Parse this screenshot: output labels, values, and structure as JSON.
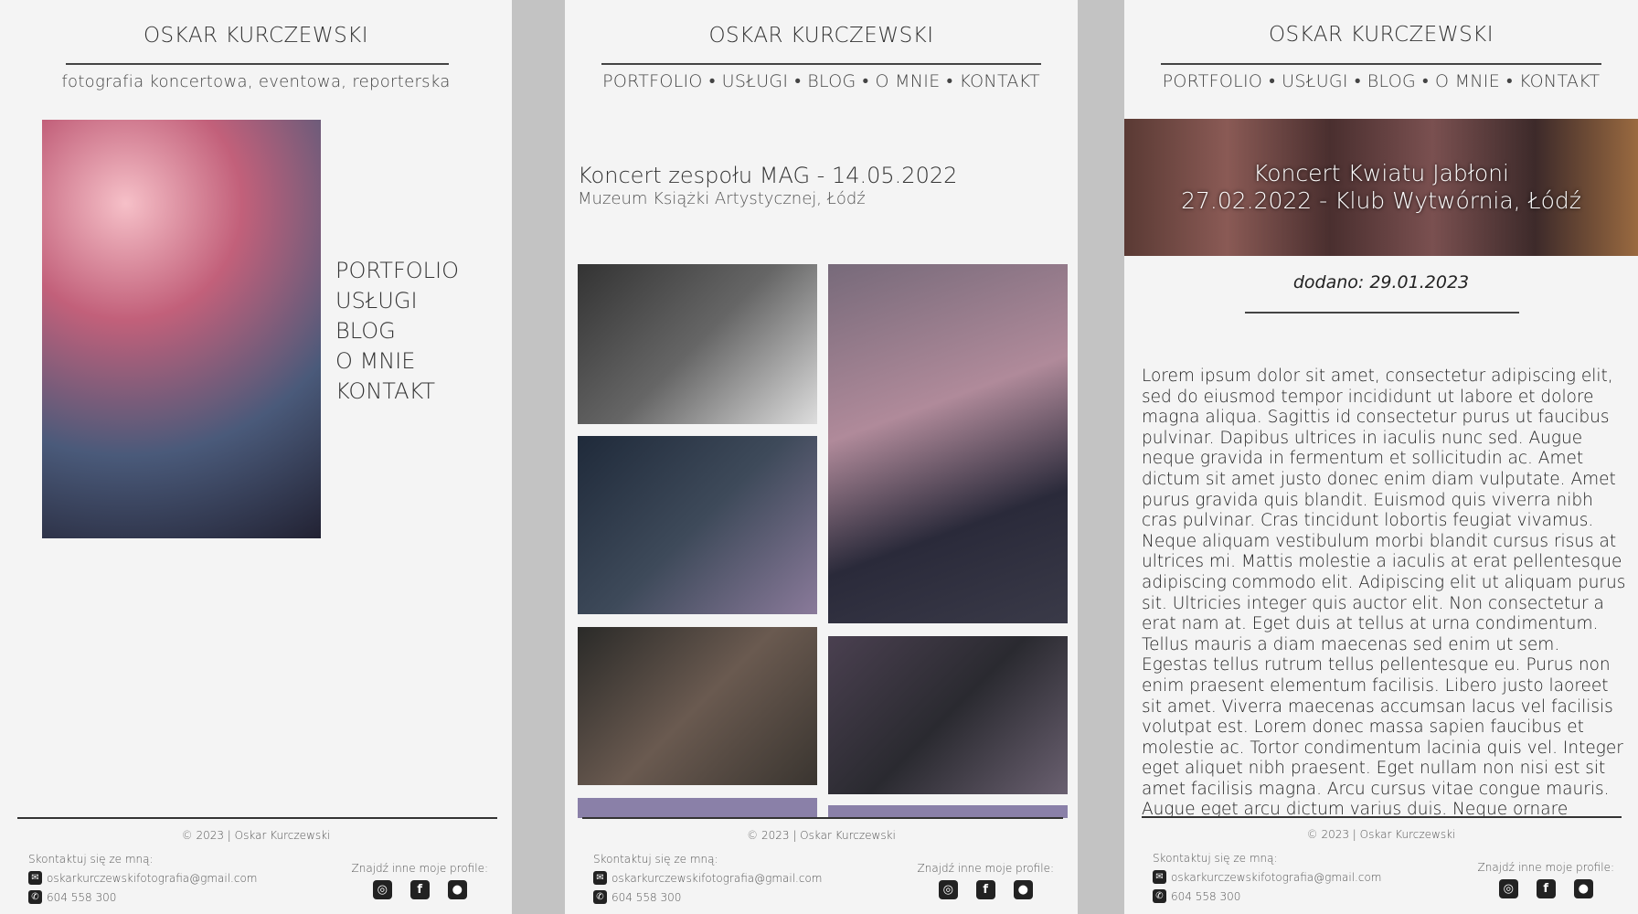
{
  "brand": "OSKAR KURCZEWSKI",
  "tagline": "fotografia koncertowa, eventowa, reporterska",
  "nav": [
    "PORTFOLIO",
    "USŁUGI",
    "BLOG",
    "O MNIE",
    "KONTAKT"
  ],
  "nav_separator": "•",
  "gallery_page": {
    "title": "Koncert zespołu MAG - 14.05.2022",
    "subtitle": "Muzeum Książki Artystycznej, Łódź"
  },
  "blog_post": {
    "banner_line1": "Koncert Kwiatu Jabłoni",
    "banner_line2": "27.02.2022 - Klub Wytwórnia, Łódź",
    "date": "dodano: 29.01.2023",
    "body": "Lorem ipsum dolor sit amet, consectetur adipiscing elit, sed do eiusmod tempor incididunt ut labore et dolore magna aliqua. Sagittis id consectetur purus ut faucibus pulvinar. Dapibus ultrices in iaculis nunc sed. Augue neque gravida in fermentum et sollicitudin ac. Amet dictum sit amet justo donec enim diam vulputate. Amet purus gravida quis blandit. Euismod quis viverra nibh cras pulvinar. Cras tincidunt lobortis feugiat vivamus. Neque aliquam vestibulum morbi blandit cursus risus at ultrices mi. Mattis molestie a iaculis at erat pellentesque adipiscing commodo elit. Adipiscing elit ut aliquam purus sit. Ultricies integer quis auctor elit. Non consectetur a erat nam at. Eget duis at tellus at urna condimentum. Tellus mauris a diam maecenas sed enim ut sem. Egestas tellus rutrum tellus pellentesque eu. Purus non enim praesent elementum facilisis. Libero justo laoreet sit amet. Viverra maecenas accumsan lacus vel facilisis volutpat est. Lorem donec massa sapien faucibus et molestie ac. Tortor condimentum lacinia quis vel. Integer eget aliquet nibh praesent. Eget nullam non nisi est sit amet facilisis magna. Arcu cursus vitae congue mauris. Augue eget arcu dictum varius duis. Neque ornare aenean euismod"
  },
  "footer": {
    "copyright": "© 2023 | Oskar Kurczewski",
    "contact_label": "Skontaktuj się ze mną:",
    "email": "oskarkurczewskifotografia@gmail.com",
    "phone": "604 558 300",
    "profiles_label": "Znajdź inne moje profile:"
  },
  "icons": {
    "email": "envelope-icon",
    "phone": "phone-icon",
    "instagram": "instagram-icon",
    "facebook": "facebook-icon",
    "github": "github-icon"
  }
}
